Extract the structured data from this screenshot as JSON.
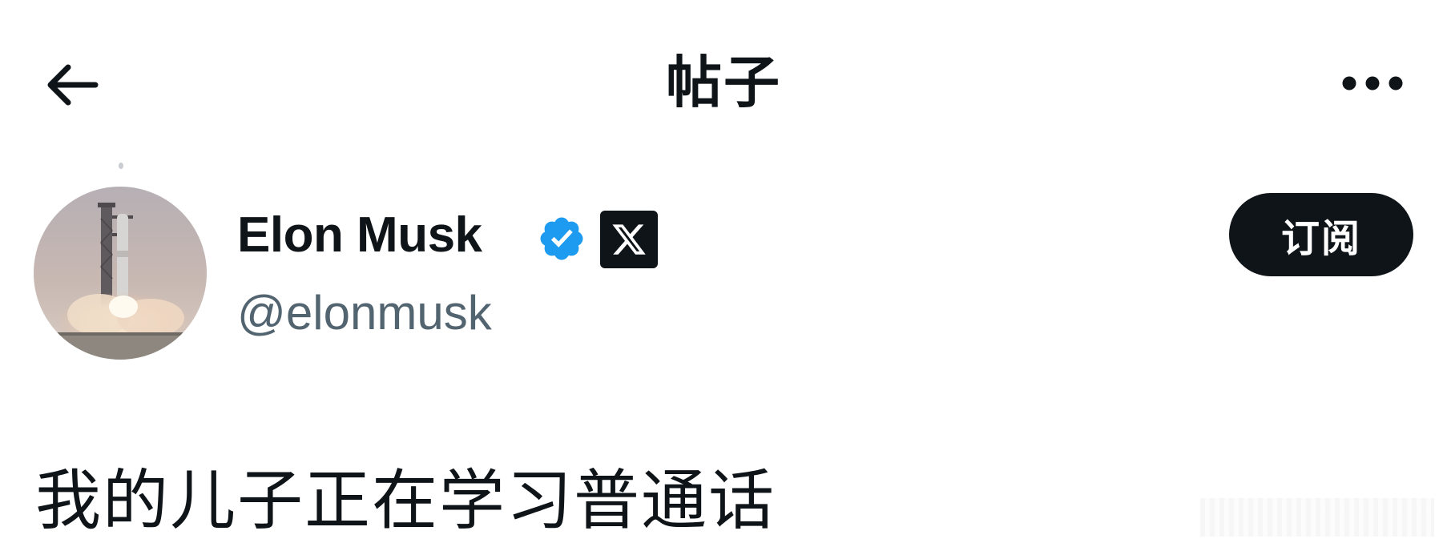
{
  "header": {
    "title": "帖子",
    "back_icon": "arrow-left-icon",
    "more_icon": "more-horizontal-icon"
  },
  "author": {
    "display_name": "Elon Musk",
    "handle": "@elonmusk",
    "verified_icon": "verified-badge-icon",
    "affiliation_icon": "x-logo-icon",
    "avatar": "rocket-launch-avatar"
  },
  "actions": {
    "subscribe_label": "订阅"
  },
  "post": {
    "text": "我的儿子正在学习普通话"
  },
  "colors": {
    "text_primary": "#0f1419",
    "text_secondary": "#536471",
    "verified_blue": "#1d9bf0",
    "button_dark": "#0f1419"
  }
}
